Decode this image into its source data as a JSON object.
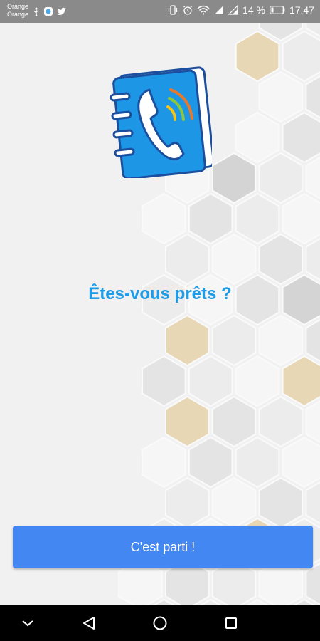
{
  "status_bar": {
    "carrier_line1": "Orange",
    "carrier_line2": "Orange",
    "notification_icons": [
      "usb-icon",
      "app-notification-icon",
      "twitter-icon"
    ],
    "status_icons": [
      "vibrate-icon",
      "alarm-icon",
      "wifi-icon",
      "signal-4g-icon",
      "signal-icon"
    ],
    "battery": "14 %",
    "time": "17:47"
  },
  "onboarding": {
    "logo_icon": "phonebook-icon",
    "headline": "Êtes-vous prêts ?",
    "start_button_label": "C'est parti !"
  },
  "nav_bar": {
    "buttons": [
      "hide-keyboard-icon",
      "back-icon",
      "home-icon",
      "recents-icon"
    ]
  },
  "colors": {
    "accent": "#1f9ce8",
    "button": "#4287f2",
    "logo_blue": "#1e96e6",
    "hex_gold": "#e8d7b4",
    "status_bar": "#8a8a8a"
  }
}
